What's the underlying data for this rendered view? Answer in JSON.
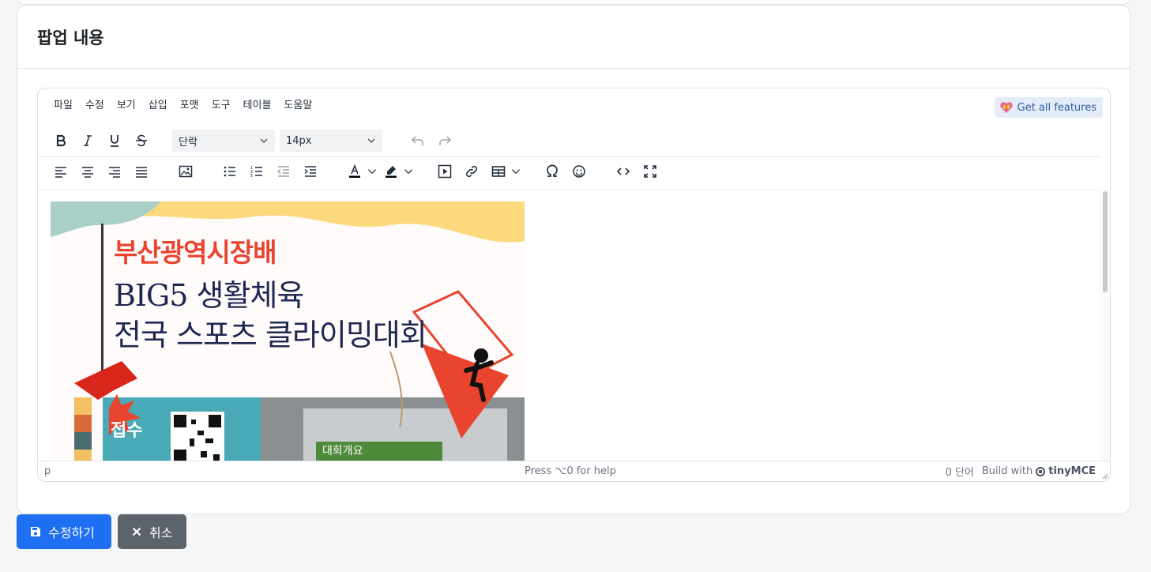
{
  "card": {
    "title": "팝업 내용"
  },
  "editor": {
    "menubar": [
      "파일",
      "수정",
      "보기",
      "삽입",
      "포맷",
      "도구",
      "테이블",
      "도움말"
    ],
    "get_features_label": "Get all features",
    "block_format": "단락",
    "font_size": "14px",
    "content": {
      "poster_line1": "부산광역시장배",
      "poster_line2": "BIG5 생활체육",
      "poster_line3": "전국 스포츠 클라이밍대회",
      "poster_badge": "접수",
      "poster_overview": "대회개요"
    },
    "statusbar": {
      "path": "p",
      "help": "Press ⌥0 for help",
      "word_count": "0 단어",
      "build_with": "Build with",
      "brand": "tinyMCE"
    }
  },
  "actions": {
    "save_label": "수정하기",
    "cancel_label": "취소"
  },
  "colors": {
    "primary": "#1e6ff2",
    "secondary": "#5c636a",
    "poster_red": "#e8442e",
    "poster_navy": "#1e2850"
  },
  "icons": [
    "bold-icon",
    "italic-icon",
    "underline-icon",
    "strikethrough-icon",
    "undo-icon",
    "redo-icon",
    "align-left-icon",
    "align-center-icon",
    "align-right-icon",
    "align-justify-icon",
    "image-icon",
    "bullet-list-icon",
    "numbered-list-icon",
    "outdent-icon",
    "indent-icon",
    "text-color-icon",
    "highlight-icon",
    "media-icon",
    "link-icon",
    "table-icon",
    "special-char-icon",
    "emoji-icon",
    "code-icon",
    "fullscreen-icon"
  ]
}
